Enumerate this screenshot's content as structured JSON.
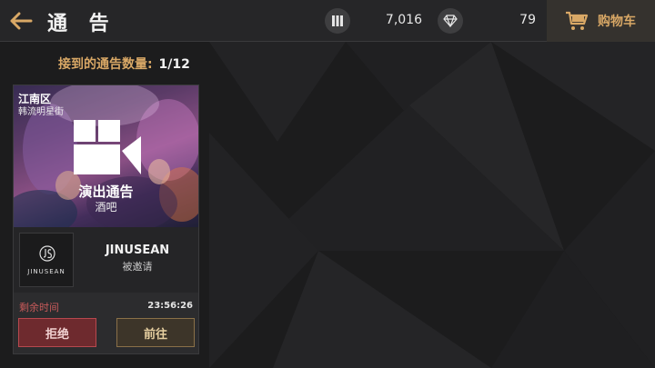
{
  "header": {
    "title": "通 告",
    "resource1": {
      "icon": "card-icon",
      "value": "7,016"
    },
    "resource2": {
      "icon": "diamond-icon",
      "value": "79"
    },
    "cart_label": "购物车"
  },
  "notice_count": {
    "label": "接到的通告数量:",
    "value": "1/12"
  },
  "card": {
    "district": "江南区",
    "street": "韩流明星街",
    "event_type": "演出通告",
    "venue": "酒吧",
    "company": {
      "logo_text": "JINUSEAN",
      "name": "JINUSEAN",
      "status": "被邀请"
    },
    "remaining_label": "剩余时间",
    "remaining_time": "23:56:26",
    "reject_label": "拒绝",
    "go_label": "前往"
  },
  "colors": {
    "accent": "#d9a866",
    "reject": "#6e2a2e",
    "go": "#3d3529"
  }
}
